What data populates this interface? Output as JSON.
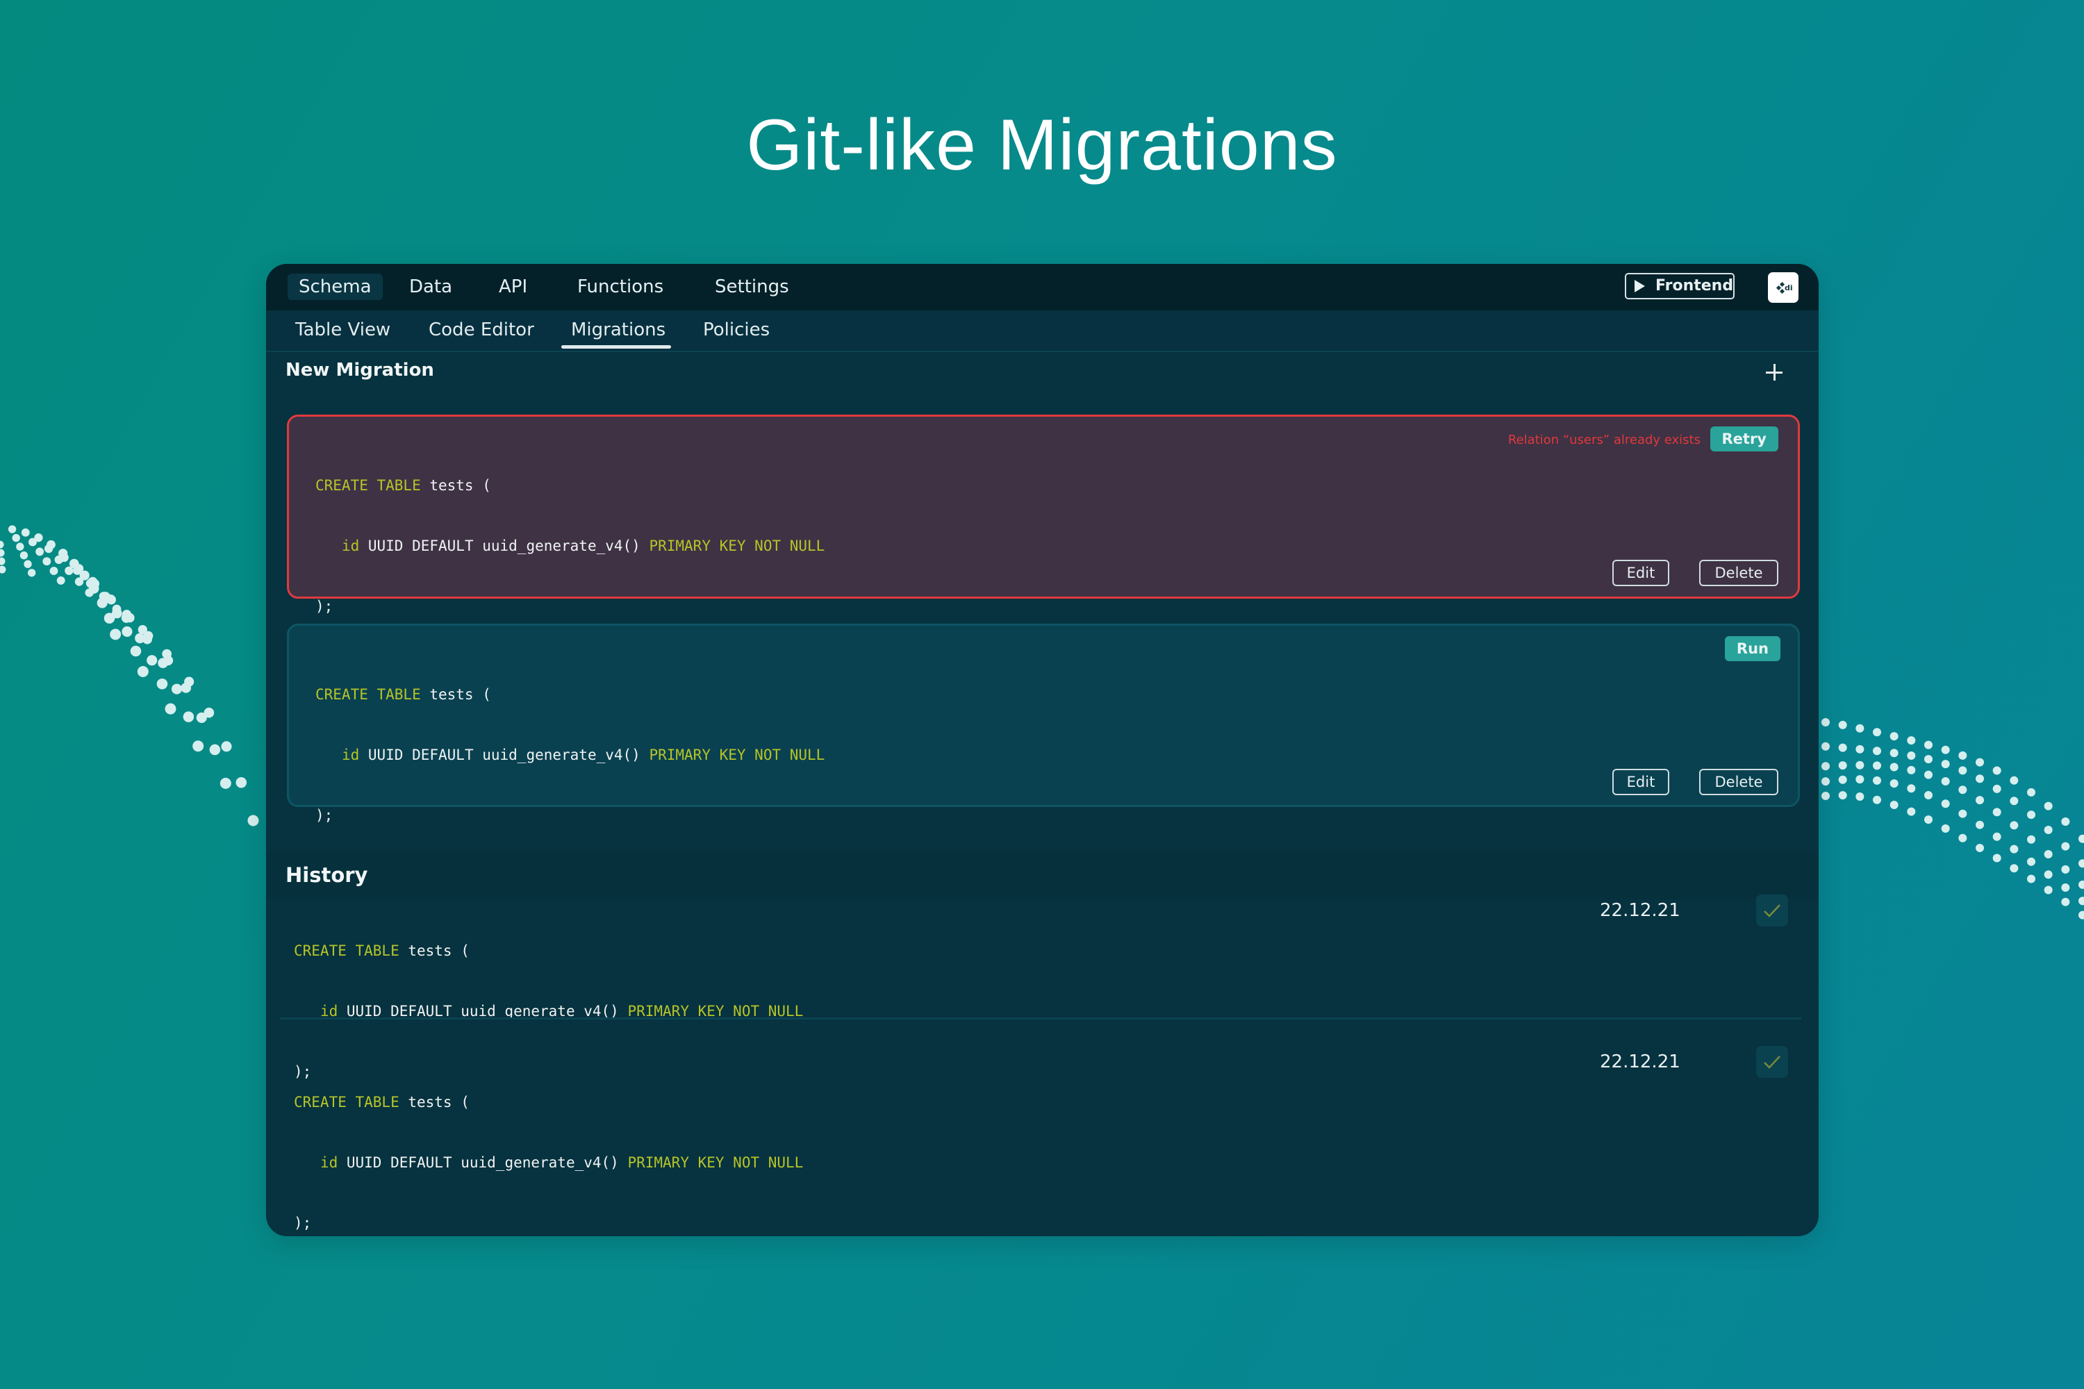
{
  "hero": {
    "title": "Git-like Migrations"
  },
  "topnav": {
    "tabs": [
      {
        "label": "Schema",
        "active": true
      },
      {
        "label": "Data",
        "active": false
      },
      {
        "label": "API",
        "active": false
      },
      {
        "label": "Functions",
        "active": false
      },
      {
        "label": "Settings",
        "active": false
      }
    ],
    "frontend_button": {
      "label": "Frontend",
      "icon": "play-icon"
    },
    "logo": {
      "text": "di",
      "icon": "dashibase-logo-icon"
    }
  },
  "subnav": {
    "tabs": [
      {
        "label": "Table View",
        "active": false
      },
      {
        "label": "Code Editor",
        "active": false
      },
      {
        "label": "Migrations",
        "active": true
      },
      {
        "label": "Policies",
        "active": false
      }
    ]
  },
  "new_migration": {
    "title": "New Migration",
    "add_icon": "plus-icon",
    "migrations": [
      {
        "status": "error",
        "code": {
          "line1": {
            "kw": "CREATE TABLE",
            "rest": " tests ("
          },
          "line2": {
            "indent": "   ",
            "kw1": "id",
            "mid": " UUID DEFAULT uuid_generate_v4() ",
            "kw2": "PRIMARY KEY NOT NULL"
          },
          "line3": ");"
        },
        "error_message": "Relation “users” already exists",
        "action_label": "Retry",
        "edit_label": "Edit",
        "delete_label": "Delete"
      },
      {
        "status": "pending",
        "code": {
          "line1": {
            "kw": "CREATE TABLE",
            "rest": " tests ("
          },
          "line2": {
            "indent": "   ",
            "kw1": "id",
            "mid": " UUID DEFAULT uuid_generate_v4() ",
            "kw2": "PRIMARY KEY NOT NULL"
          },
          "line3": ");"
        },
        "action_label": "Run",
        "edit_label": "Edit",
        "delete_label": "Delete"
      }
    ]
  },
  "history": {
    "title": "History",
    "items": [
      {
        "code": {
          "line1": {
            "kw": "CREATE TABLE",
            "rest": " tests ("
          },
          "line2": {
            "indent": "   ",
            "kw1": "id",
            "mid": " UUID DEFAULT uuid_generate_v4() ",
            "kw2": "PRIMARY KEY NOT NULL"
          },
          "line3": ");"
        },
        "date": "22.12.21",
        "status_icon": "check-icon"
      },
      {
        "code": {
          "line1": {
            "kw": "CREATE TABLE",
            "rest": " tests ("
          },
          "line2": {
            "indent": "   ",
            "kw1": "id",
            "mid": " UUID DEFAULT uuid_generate_v4() ",
            "kw2": "PRIMARY KEY NOT NULL"
          },
          "line3": ");"
        },
        "date": "22.12.21",
        "status_icon": "check-icon"
      }
    ]
  },
  "colors": {
    "background": "#068a8c",
    "window": "#07323f",
    "topnav": "#04212a",
    "error_border": "#e03a3e",
    "error_card": "#3f3244",
    "accent_button": "#2aa39b",
    "sql_keyword": "#b6c428"
  }
}
